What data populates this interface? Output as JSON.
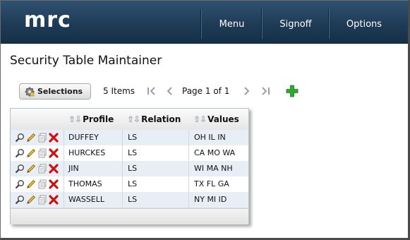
{
  "app": {
    "logo": "mrc",
    "nav": [
      "Menu",
      "Signoff",
      "Options"
    ]
  },
  "page": {
    "title": "Security Table Maintainer"
  },
  "toolbar": {
    "selections_label": "Selections",
    "items_count": "5 Items",
    "page_text": "Page 1 of 1"
  },
  "table": {
    "columns": [
      "Profile",
      "Relation",
      "Values"
    ],
    "rows": [
      {
        "profile": "DUFFEY",
        "relation": "LS",
        "values": "OH IL IN"
      },
      {
        "profile": "HURCKES",
        "relation": "LS",
        "values": "CA MO WA"
      },
      {
        "profile": "JIN",
        "relation": "LS",
        "values": "WI MA NH"
      },
      {
        "profile": "THOMAS",
        "relation": "LS",
        "values": "TX FL GA"
      },
      {
        "profile": "WASSELL",
        "relation": "LS",
        "values": "NY MI ID"
      }
    ]
  },
  "icons": {
    "selections": "gear-icon",
    "first_page": "first-page-icon",
    "prev_page": "chevron-left-icon",
    "next_page": "chevron-right-icon",
    "last_page": "last-page-icon",
    "add": "plus-icon",
    "row_actions": [
      "magnifier-icon",
      "pencil-icon",
      "copy-icon",
      "delete-icon"
    ]
  },
  "colors": {
    "header": "#1d3a55",
    "row_alt": "#e8eef6",
    "add": "#2eaa2e",
    "delete": "#d01010"
  }
}
